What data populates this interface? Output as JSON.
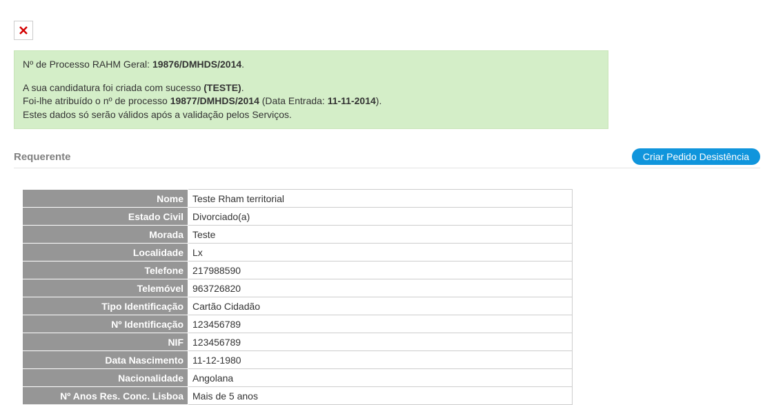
{
  "success": {
    "proc_label": "Nº de Processo RAHM Geral: ",
    "proc_number": "19876/DMHDS/2014",
    "created_prefix": "A sua candidatura foi criada com sucesso ",
    "created_tag": "(TESTE)",
    "assigned_prefix": "Foi-lhe atribuído o nº de processo ",
    "assigned_number": "19877/DMHDS/2014",
    "entry_prefix": " (Data Entrada: ",
    "entry_date": "11-11-2014",
    "entry_suffix": ").",
    "validation_note": "Estes dados só serão válidos após a validação pelos Serviços."
  },
  "section": {
    "title": "Requerente",
    "button": "Criar Pedido Desistência"
  },
  "applicant": {
    "rows": [
      {
        "label": "Nome",
        "value": "Teste Rham territorial"
      },
      {
        "label": "Estado Civil",
        "value": "Divorciado(a)"
      },
      {
        "label": "Morada",
        "value": "Teste"
      },
      {
        "label": "Localidade",
        "value": "Lx"
      },
      {
        "label": "Telefone",
        "value": "217988590"
      },
      {
        "label": "Telemóvel",
        "value": "963726820"
      },
      {
        "label": "Tipo Identificação",
        "value": "Cartão Cidadão"
      },
      {
        "label": "Nº Identificação",
        "value": "123456789"
      },
      {
        "label": "NIF",
        "value": "123456789"
      },
      {
        "label": "Data Nascimento",
        "value": "11-12-1980"
      },
      {
        "label": "Nacionalidade",
        "value": "Angolana"
      },
      {
        "label": "Nº Anos Res. Conc. Lisboa",
        "value": "Mais de 5 anos"
      }
    ]
  }
}
